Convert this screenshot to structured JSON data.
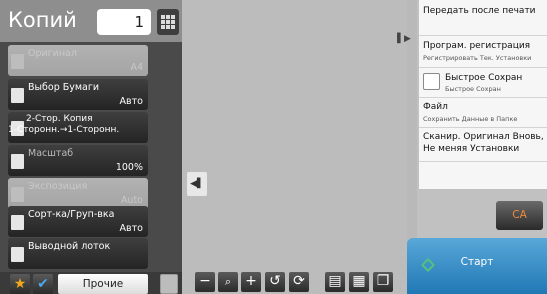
{
  "copies": {
    "title": "Копий",
    "count": "1"
  },
  "modes": [
    {
      "id": "original",
      "label": "Оригинал",
      "value": "A4",
      "enabled": false
    },
    {
      "id": "paper",
      "label": "Выбор Бумаги",
      "value": "Авто",
      "enabled": true
    },
    {
      "id": "duplex",
      "label_line1": "2-Стор. Копия",
      "label_line2": "1-Сторонн.→1-Сторонн.",
      "enabled": true
    },
    {
      "id": "ratio",
      "label": "Масштаб",
      "value": "100%",
      "enabled": true
    },
    {
      "id": "exposure",
      "label": "Экспозиция",
      "value": "Auto",
      "enabled": false
    },
    {
      "id": "sort",
      "label": "Сорт-ка/Груп-вка",
      "value": "Авто",
      "enabled": true
    },
    {
      "id": "output",
      "label": "Выводной лоток",
      "value": "",
      "enabled": true
    }
  ],
  "bottom": {
    "other_label": "Прочие"
  },
  "toolbar_icons": [
    "minus-icon",
    "zoom-icon",
    "plus-icon",
    "rotate-icon",
    "refresh-icon",
    "page-view-icon",
    "thumbnail-view-icon",
    "multi-page-icon"
  ],
  "toolbar_glyphs": [
    "−",
    "🔍",
    "+",
    "↺",
    "⟳",
    "▤",
    "▦",
    "❐"
  ],
  "shortcuts": [
    {
      "main": "Передать после печати",
      "sub": ""
    },
    {
      "main": "Програм. регистрация",
      "sub": "Регистрировать Тек. Установки"
    },
    {
      "main": "Быстрое Сохран",
      "sub": "Быстрое Сохран"
    },
    {
      "main": "Файл",
      "sub": "Сохранить Данные в Папке"
    },
    {
      "main_line1": "Сканир. Оригинал Вновь,",
      "main_line2": "Не меняя Установки"
    }
  ],
  "actions": {
    "ca_label": "CA",
    "start_label": "Старт"
  },
  "colors": {
    "start": "#2f8ac8",
    "ca_text": "#f08a3c",
    "star": "#f2a81c",
    "check": "#4aa6e8"
  }
}
